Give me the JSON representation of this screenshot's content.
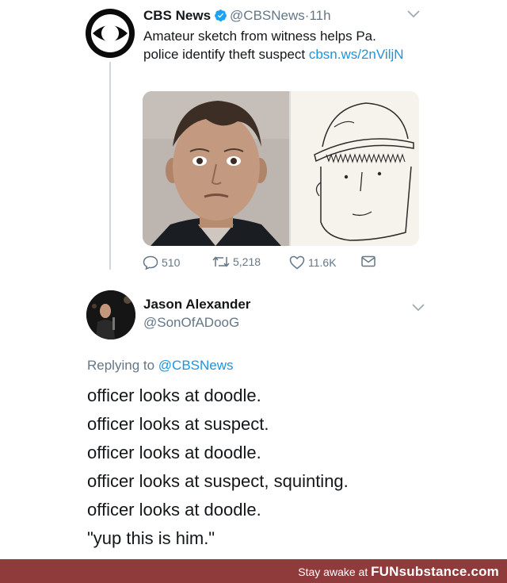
{
  "tweet1": {
    "author_name": "CBS News",
    "verified_icon": "verified-badge-icon",
    "handle": "@CBSNews",
    "separator": "·",
    "time": "11h",
    "text_main": "Amateur sketch from witness helps Pa. police identify theft suspect ",
    "text_link": "cbsn.ws/2nViljN",
    "actions": {
      "replies": "510",
      "retweets": "5,218",
      "likes": "11.6K"
    }
  },
  "tweet2": {
    "author_name": "Jason Alexander",
    "handle": "@SonOfADooG",
    "replying_prefix": "Replying to ",
    "replying_handle": "@CBSNews",
    "lines": [
      "officer looks at doodle.",
      "officer looks at suspect.",
      "officer looks at doodle.",
      "officer looks at suspect, squinting.",
      "officer looks at doodle.",
      "\"yup this is him.\""
    ]
  },
  "footer": {
    "text": "Stay awake at ",
    "brand": "FUNsubstance.com"
  },
  "colors": {
    "link": "#1b95e0",
    "muted": "#657786",
    "footer_bg": "#8f3a3b"
  }
}
